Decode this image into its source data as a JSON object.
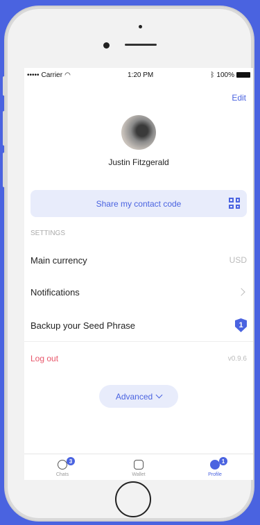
{
  "status_bar": {
    "carrier": "Carrier",
    "time": "1:20 PM",
    "battery": "100%"
  },
  "header": {
    "edit_label": "Edit"
  },
  "profile": {
    "name": "Justin Fitzgerald"
  },
  "share": {
    "label": "Share my contact code"
  },
  "settings": {
    "section_label": "SETTINGS",
    "main_currency": {
      "label": "Main currency",
      "value": "USD"
    },
    "notifications": {
      "label": "Notifications"
    },
    "backup": {
      "label": "Backup your Seed Phrase",
      "badge": "1"
    },
    "logout": {
      "label": "Log out",
      "version": "v0.9.6"
    }
  },
  "advanced": {
    "label": "Advanced"
  },
  "tabs": [
    {
      "label": "Chats",
      "badge": "3"
    },
    {
      "label": "Wallet"
    },
    {
      "label": "Profile",
      "badge": "1",
      "active": true
    }
  ],
  "colors": {
    "accent": "#4a63e0",
    "danger": "#e8566a",
    "background": "#4a63e0"
  }
}
